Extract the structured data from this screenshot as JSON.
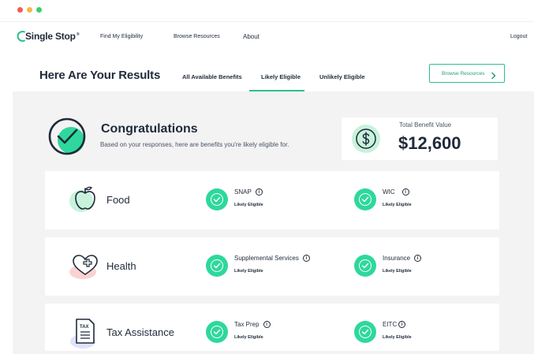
{
  "nav": {
    "logo_text": "Single Stop",
    "logo_tm": "®",
    "links": [
      "Find My Eligibility",
      "Browse Resources",
      "About"
    ],
    "logout": "Logout"
  },
  "header": {
    "title": "Here Are Your Results",
    "tabs": [
      {
        "label": "All Available Benefits"
      },
      {
        "label": "Likely Eligible",
        "active": true
      },
      {
        "label": "Unlikely Eligible"
      }
    ],
    "browse_button": "Browse Resources"
  },
  "congrats": {
    "title": "Congratulations",
    "subtitle": "Based on your responses, here are benefits you're likely eligible for."
  },
  "total": {
    "label": "Total Benefit Value",
    "value": "$12,600"
  },
  "categories": [
    {
      "name": "Food",
      "icon": "apple-icon",
      "benefits": [
        {
          "name": "SNAP",
          "status": "Likely Eligible"
        },
        {
          "name": "WIC",
          "status": "Likely Eligible"
        }
      ]
    },
    {
      "name": "Health",
      "icon": "heart-plus-icon",
      "benefits": [
        {
          "name": "Supplemental Services",
          "status": "Likely Eligible"
        },
        {
          "name": "Insurance",
          "status": "Likely Eligible"
        }
      ]
    },
    {
      "name": "Tax Assistance",
      "icon": "tax-document-icon",
      "benefits": [
        {
          "name": "Tax Prep",
          "status": "Likely Eligible"
        },
        {
          "name": "EITC",
          "status": "Likely Eligible"
        }
      ]
    }
  ],
  "colors": {
    "accent": "#2dbf8f",
    "check": "#2ed89d",
    "text": "#1f2a3a",
    "background": "#f3f3f3"
  }
}
